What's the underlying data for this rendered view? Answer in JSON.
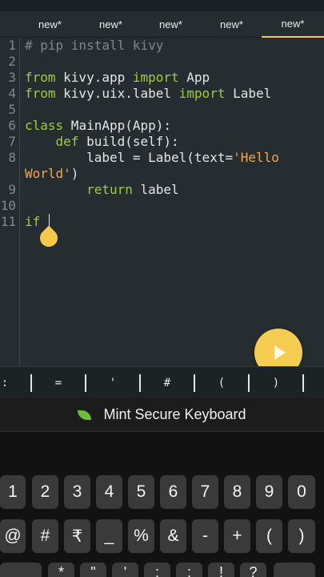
{
  "tabs": [
    {
      "label": "new*",
      "active": false
    },
    {
      "label": "new*",
      "active": false
    },
    {
      "label": "new*",
      "active": false
    },
    {
      "label": "new*",
      "active": false
    },
    {
      "label": "new*",
      "active": true
    }
  ],
  "editor": {
    "line_numbers": [
      "1",
      "2",
      "3",
      "4",
      "5",
      "6",
      "7",
      "8",
      "9",
      "10",
      "11"
    ],
    "code": {
      "l1": "# pip install kivy",
      "l3_kw1": "from",
      "l3_mod": " kivy.app ",
      "l3_kw2": "import",
      "l3_name": " App",
      "l4_kw1": "from",
      "l4_mod": " kivy.uix.label ",
      "l4_kw2": "import",
      "l4_name": " Label",
      "l6_kw": "class",
      "l6_rest": " MainApp(App):",
      "l7_indent": "    ",
      "l7_kw": "def",
      "l7_rest": " build(self):",
      "l8_pre": "        label = Label(text=",
      "l8_str": "'Hello",
      "l8b_str": "World'",
      "l8b_rest": ")",
      "l9_indent": "        ",
      "l9_kw": "return",
      "l9_rest": " label",
      "l11_kw": "if",
      "l11_rest": " "
    }
  },
  "symbols": [
    ":",
    "=",
    "'",
    "#",
    "(",
    ")"
  ],
  "keyboard": {
    "title": "Mint Secure Keyboard",
    "row1": [
      "1",
      "2",
      "3",
      "4",
      "5",
      "6",
      "7",
      "8",
      "9",
      "0"
    ],
    "row2": [
      "@",
      "#",
      "₹",
      "_",
      "%",
      "&",
      "-",
      "+",
      "(",
      ")"
    ],
    "row3": [
      "*",
      "\"",
      "'",
      ":",
      ";",
      "!",
      "?"
    ]
  },
  "colors": {
    "accent": "#f6cd53",
    "keyword": "#9ecd3f",
    "string": "#f0a552",
    "comment": "#7d878c"
  }
}
